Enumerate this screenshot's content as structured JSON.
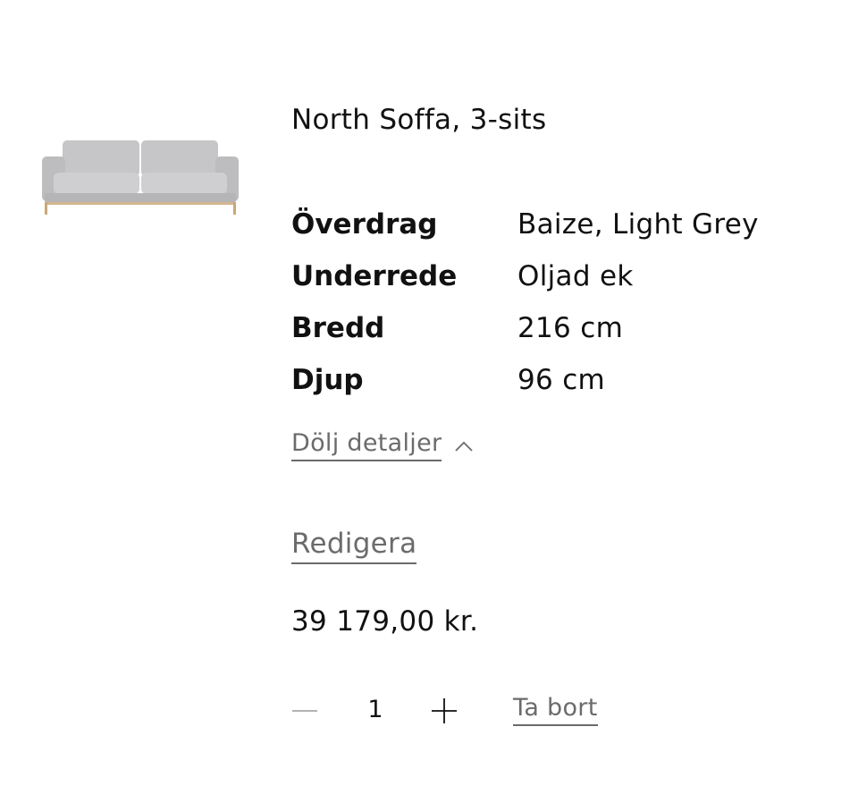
{
  "product": {
    "name": "North Soffa, 3-sits",
    "image_icon": "sofa-icon"
  },
  "specs": [
    {
      "label": "Överdrag",
      "value": "Baize, Light Grey"
    },
    {
      "label": "Underrede",
      "value": "Oljad ek"
    },
    {
      "label": "Bredd",
      "value": "216 cm"
    },
    {
      "label": "Djup",
      "value": "96 cm"
    }
  ],
  "actions": {
    "hide_details_label": "Dölj detaljer",
    "edit_label": "Redigera",
    "remove_label": "Ta bort"
  },
  "price": "39 179,00 kr.",
  "quantity": {
    "value": "1",
    "minus_icon": "minus-icon",
    "plus_icon": "plus-icon"
  },
  "colors": {
    "text": "#111111",
    "muted": "#6b6b6b",
    "sofa_fabric": "#c9c9cb",
    "sofa_legs": "#d2b48c"
  }
}
